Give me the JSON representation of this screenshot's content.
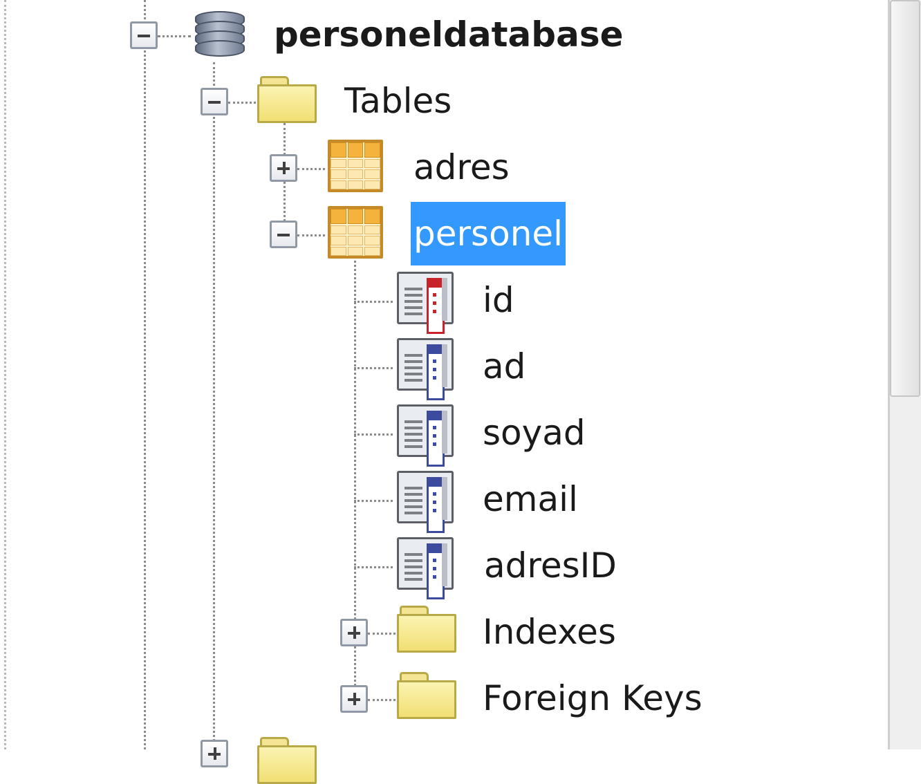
{
  "tree": {
    "database": {
      "label": "personeldatabase",
      "expanded": true
    },
    "tables_folder": {
      "label": "Tables",
      "expanded": true
    },
    "tables": [
      {
        "label": "adres",
        "expanded": false
      },
      {
        "label": "personel",
        "expanded": true,
        "selected": true
      }
    ],
    "columns": [
      {
        "label": "id",
        "primary_key": true
      },
      {
        "label": "ad"
      },
      {
        "label": "soyad"
      },
      {
        "label": "email"
      },
      {
        "label": "adresID"
      }
    ],
    "subfolders": [
      {
        "label": "Indexes",
        "expanded": false
      },
      {
        "label": "Foreign Keys",
        "expanded": false
      }
    ]
  },
  "colors": {
    "selection": "#3399ff",
    "folder": "#f1df74",
    "table_icon": "#f3b33c",
    "pk_icon": "#c8222a",
    "column_icon": "#3d4b9e"
  },
  "icons": [
    "database-icon",
    "folder-icon",
    "table-icon",
    "column-icon",
    "primary-key-column-icon",
    "expand-icon",
    "collapse-icon"
  ]
}
